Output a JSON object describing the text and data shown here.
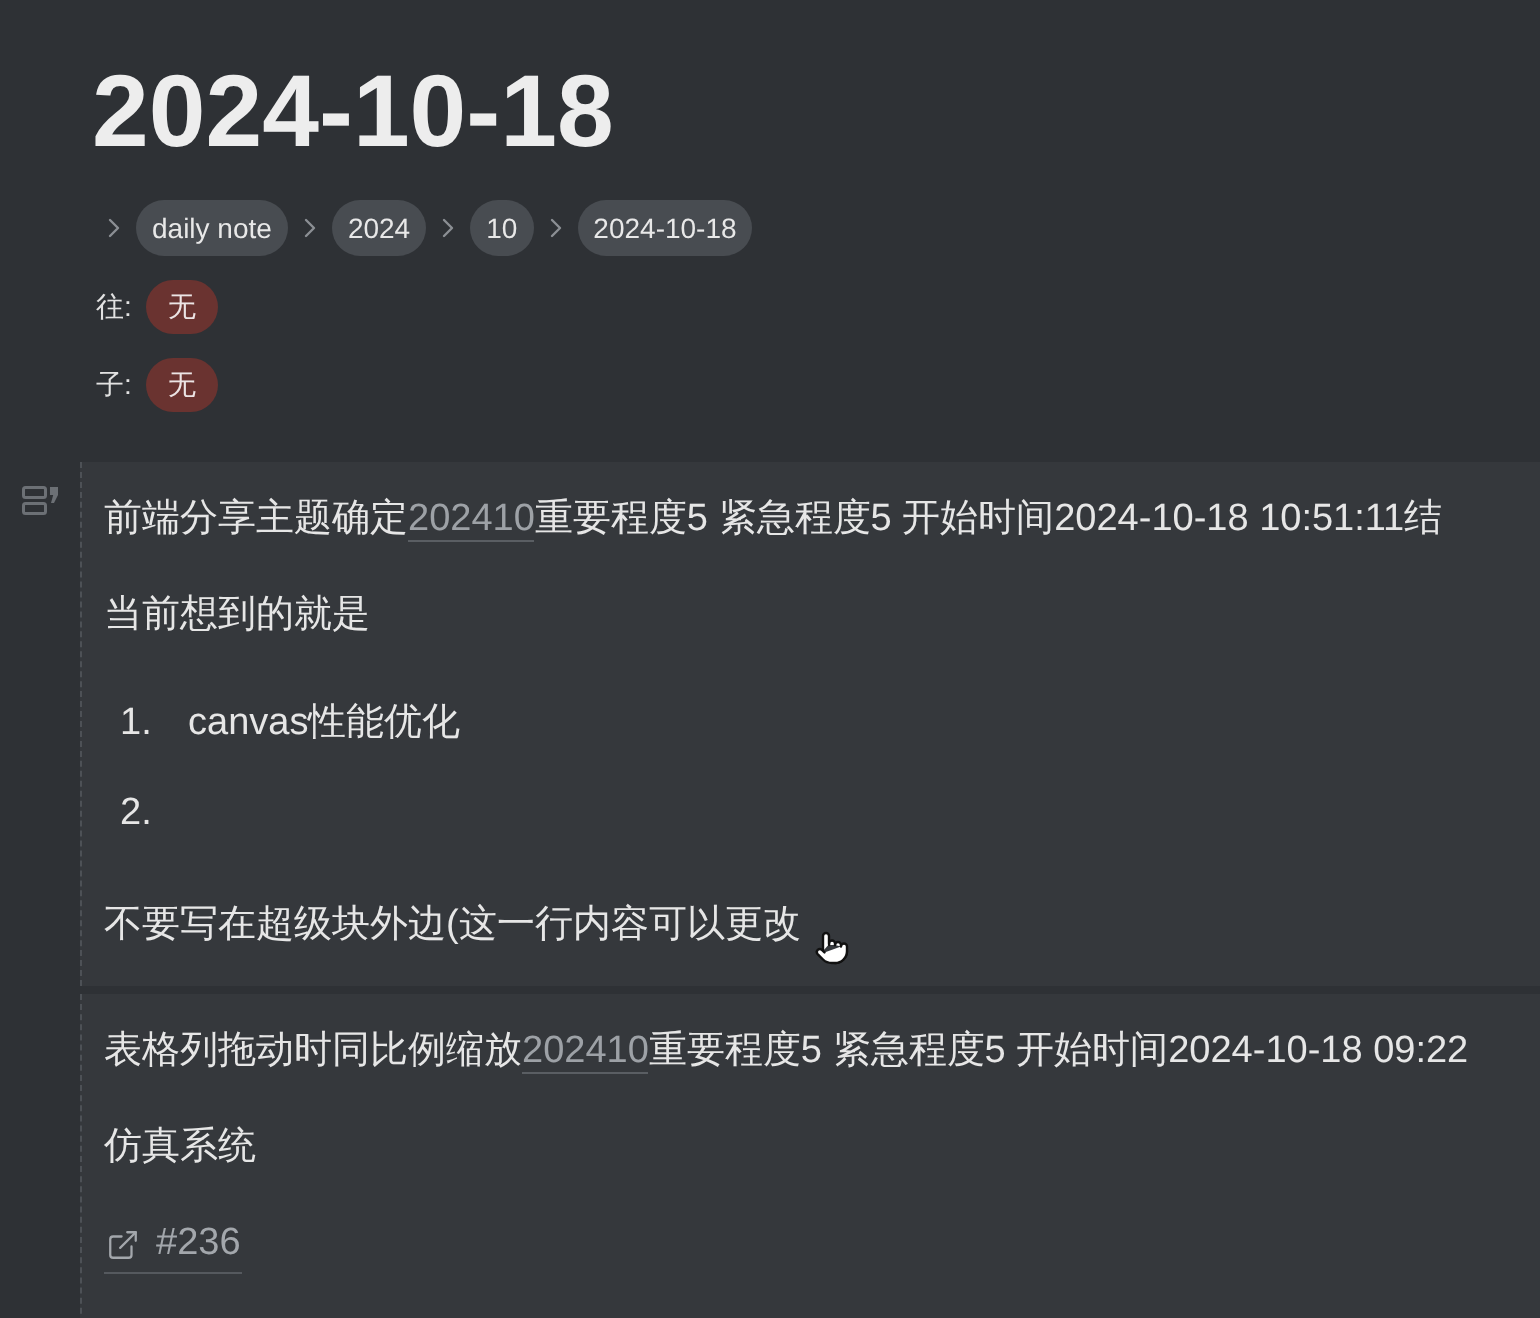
{
  "page": {
    "title": "2024-10-18"
  },
  "breadcrumb": [
    {
      "label": "daily note"
    },
    {
      "label": "2024"
    },
    {
      "label": "10"
    },
    {
      "label": "2024-10-18"
    }
  ],
  "relations": [
    {
      "label": "往:",
      "tags": [
        "无"
      ]
    },
    {
      "label": "子:",
      "tags": [
        "无"
      ]
    }
  ],
  "blocks": [
    {
      "items": [
        {
          "kind": "task",
          "before": "前端分享主题确定",
          "ref": "202410",
          "after": "重要程度5 紧急程度5 开始时间2024-10-18 10:51:11结"
        },
        {
          "kind": "paragraph",
          "text": "当前想到的就是"
        },
        {
          "kind": "list",
          "items": [
            {
              "marker": "1.",
              "text": "canvas性能优化"
            },
            {
              "marker": "2."
            }
          ]
        },
        {
          "kind": "paragraph",
          "text": "不要写在超级块外边(这一行内容可以更改"
        }
      ]
    },
    {
      "items": [
        {
          "kind": "task",
          "before": "表格列拖动时同比例缩放",
          "ref": "202410",
          "after": "重要程度5 紧急程度5 开始时间2024-10-18 09:22"
        },
        {
          "kind": "paragraph",
          "text": "仿真系统"
        },
        {
          "kind": "link",
          "text": "#236"
        }
      ]
    }
  ]
}
